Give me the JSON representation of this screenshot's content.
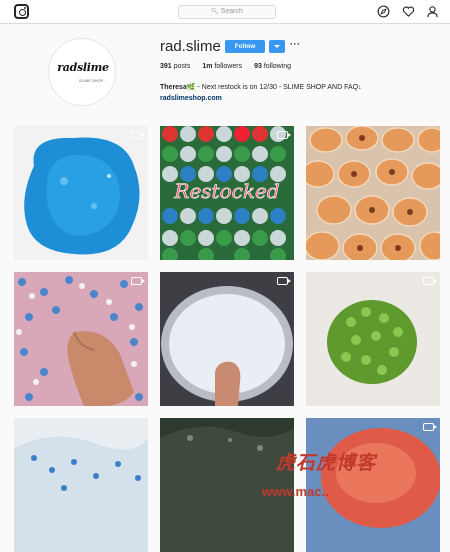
{
  "header": {
    "search_placeholder": "Search"
  },
  "profile": {
    "picture_brand": "radslime",
    "picture_tagline": "SLIME SHOP",
    "username": "rad.slime",
    "follow_label": "Follow",
    "more_label": "···",
    "stats": {
      "posts_count": "391",
      "posts_label": "posts",
      "followers_count": "1m",
      "followers_label": "followers",
      "following_count": "93",
      "following_label": "following"
    },
    "bio_name": "Theresa",
    "bio_emoji": "🌿",
    "bio_text": "- Next restock is on 12/30 - SLIME SHOP AND FAQ↓",
    "bio_link": "radslimeshop.com"
  },
  "posts": [
    {
      "name": "blue-slime",
      "video": true
    },
    {
      "name": "restocked-jars",
      "video": true,
      "overlay_text": "Restocked"
    },
    {
      "name": "orange-jars",
      "video": false
    },
    {
      "name": "floam-hand",
      "video": true
    },
    {
      "name": "bowl-slime",
      "video": true
    },
    {
      "name": "green-floam-ball",
      "video": true
    },
    {
      "name": "blue-white-slime",
      "video": false
    },
    {
      "name": "dark-slime",
      "video": false
    },
    {
      "name": "red-slime",
      "video": true
    }
  ],
  "watermark": {
    "text": "虎石虎博客",
    "url": "www.mac.."
  },
  "colors": {
    "accent": "#3897f0",
    "link": "#003569"
  }
}
